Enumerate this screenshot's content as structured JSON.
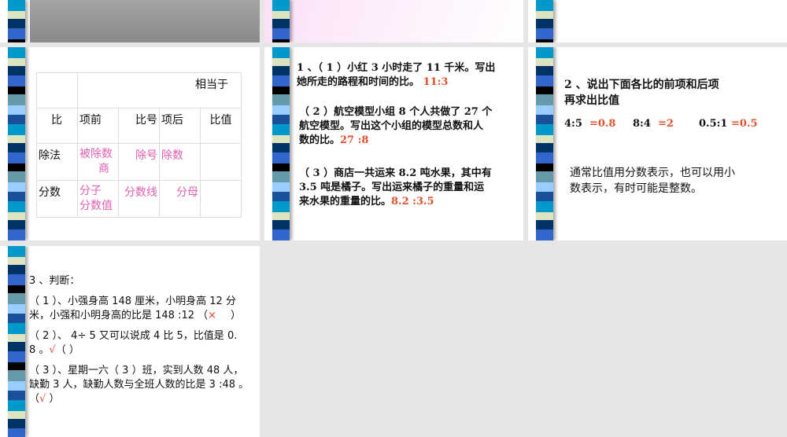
{
  "stripe_colors": [
    "#0099cc",
    "#dde5c0",
    "#003366",
    "#3366cc",
    "#000000",
    "#6699aa",
    "#99ccff"
  ],
  "accent_red": "#e0502a",
  "accent_pink": "#e060b0",
  "slide4": {
    "table": {
      "header": "相当于",
      "row1": [
        "比",
        "项前",
        "比号",
        "项后",
        "比值"
      ],
      "row2": [
        "除法",
        "被除数",
        "商",
        "除号",
        "除数"
      ],
      "row3": [
        "分数",
        "分子",
        "分数值",
        "分数线",
        "分母"
      ]
    }
  },
  "slide5": {
    "q1": [
      "1 、（ 1 ）小红 3 小时走了 11 千米。写出",
      "她所走的路程和时间的比。"
    ],
    "a1": "11:3",
    "q2": [
      "（ 2 ）航空模型小组 8 个人共做了 27 个",
      "航空模型。写出这个小组的模型总数和人",
      "数的比。"
    ],
    "a2": "27 :8",
    "q3": [
      "（ 3 ）商店一共运来 8.2 吨水果，其中有",
      "3.5 吨是橘子。写出运来橘子的重量和运",
      "来水果的重量的比。"
    ],
    "a3": "8.2 :3.5"
  },
  "slide6": {
    "title": [
      "2 、说出下面各比的前项和后项",
      "再求出比值"
    ],
    "ratios": [
      {
        "r": "4:5",
        "v": "=0.8"
      },
      {
        "r": "8:4",
        "v": "=2"
      },
      {
        "r": "0.5:1",
        "v": "=0.5"
      }
    ],
    "note": [
      "通常比值用分数表示，也可以用小",
      "数表示，有时可能是整数。"
    ]
  },
  "slide7": {
    "title": "3 、判断：",
    "j1": [
      "（ 1 ）、小强身高 148 厘米，小明身高 12 分",
      "米，小强和小明身高的比是 148 :12 （",
      "）"
    ],
    "m1": "×",
    "j2": [
      "（ 2 ）、 4÷ 5 又可以说成 4  比 5，比值是  0.",
      "8 。",
      "（       ）"
    ],
    "m2": "√",
    "j3": [
      "（ 3 ）、星期一六（ 3 ）班，实到人数 48 人，",
      "缺勤 3 人，缺勤人数与全班人数的比是 3 :48 。",
      "（",
      "       ）"
    ],
    "m3": "√"
  }
}
